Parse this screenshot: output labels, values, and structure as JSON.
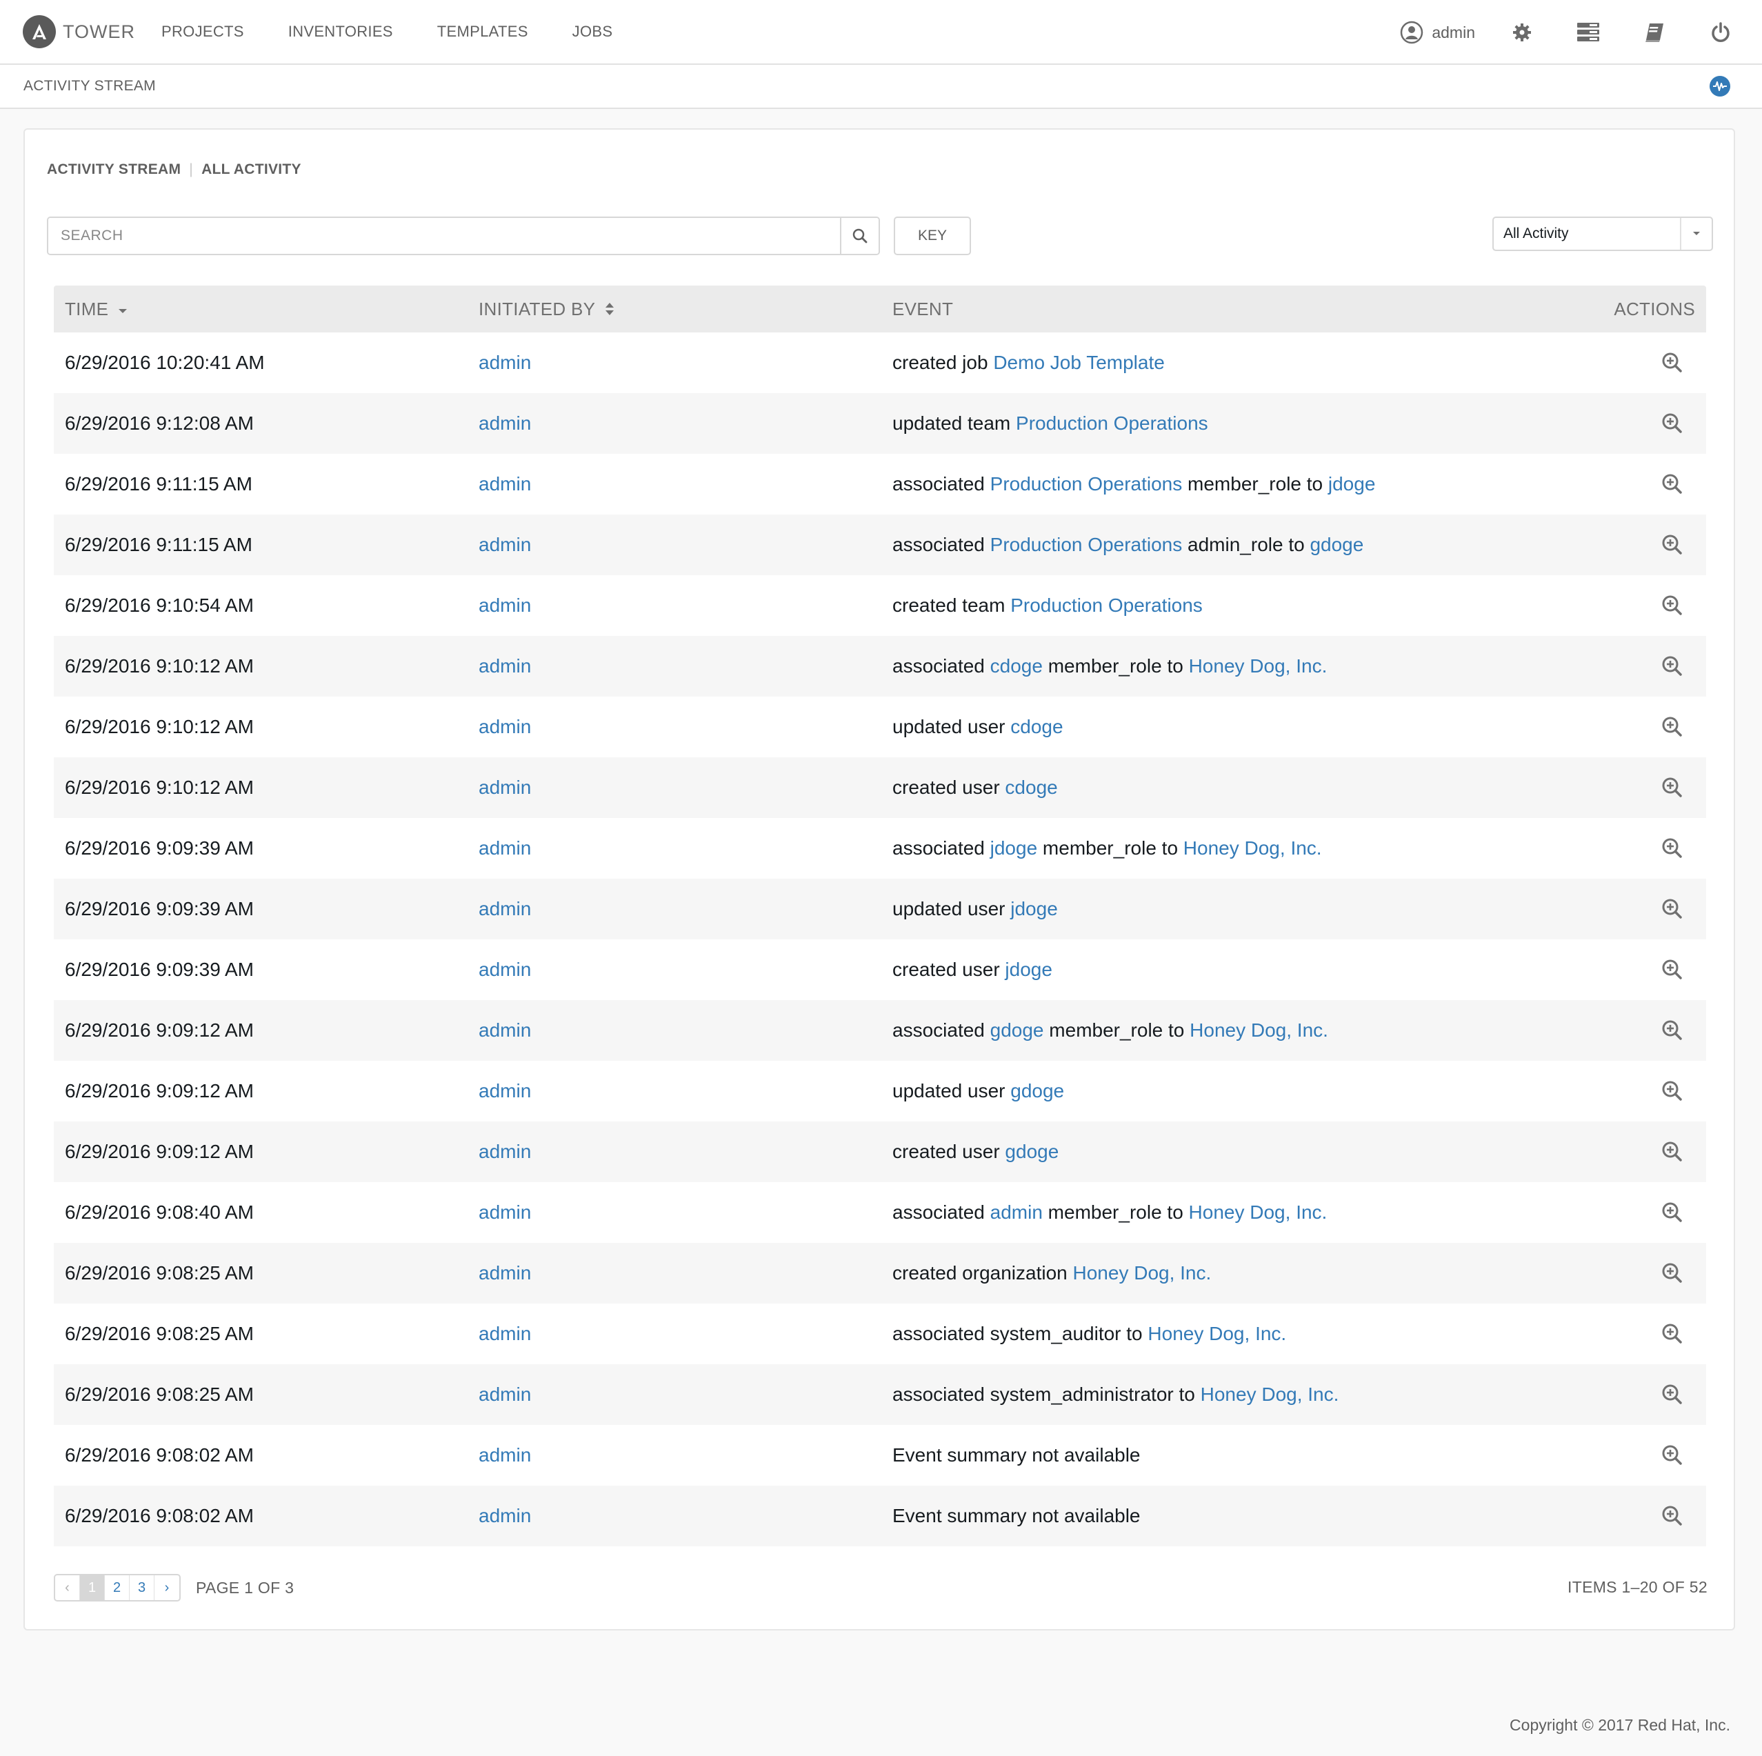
{
  "brand": {
    "name": "TOWER"
  },
  "nav": {
    "links": [
      "PROJECTS",
      "INVENTORIES",
      "TEMPLATES",
      "JOBS"
    ],
    "user": "admin"
  },
  "breadcrumb": "ACTIVITY STREAM",
  "panel": {
    "title": "ACTIVITY STREAM",
    "subtitle": "ALL ACTIVITY",
    "search_placeholder": "SEARCH",
    "key_label": "KEY",
    "filter_value": "All Activity"
  },
  "table": {
    "headers": {
      "time": "TIME",
      "initiated_by": "INITIATED BY",
      "event": "EVENT",
      "actions": "ACTIONS"
    },
    "rows": [
      {
        "time": "6/29/2016 10:20:41 AM",
        "user": "admin",
        "event": [
          [
            "created job ",
            false
          ],
          [
            "Demo Job Template",
            true
          ]
        ]
      },
      {
        "time": "6/29/2016 9:12:08 AM",
        "user": "admin",
        "event": [
          [
            "updated team ",
            false
          ],
          [
            "Production Operations",
            true
          ]
        ]
      },
      {
        "time": "6/29/2016 9:11:15 AM",
        "user": "admin",
        "event": [
          [
            "associated ",
            false
          ],
          [
            "Production Operations",
            true
          ],
          [
            " member_role to ",
            false
          ],
          [
            "jdoge",
            true
          ]
        ]
      },
      {
        "time": "6/29/2016 9:11:15 AM",
        "user": "admin",
        "event": [
          [
            "associated ",
            false
          ],
          [
            "Production Operations",
            true
          ],
          [
            " admin_role to ",
            false
          ],
          [
            "gdoge",
            true
          ]
        ]
      },
      {
        "time": "6/29/2016 9:10:54 AM",
        "user": "admin",
        "event": [
          [
            "created team ",
            false
          ],
          [
            "Production Operations",
            true
          ]
        ]
      },
      {
        "time": "6/29/2016 9:10:12 AM",
        "user": "admin",
        "event": [
          [
            "associated ",
            false
          ],
          [
            "cdoge",
            true
          ],
          [
            " member_role to ",
            false
          ],
          [
            "Honey Dog, Inc.",
            true
          ]
        ]
      },
      {
        "time": "6/29/2016 9:10:12 AM",
        "user": "admin",
        "event": [
          [
            "updated user ",
            false
          ],
          [
            "cdoge",
            true
          ]
        ]
      },
      {
        "time": "6/29/2016 9:10:12 AM",
        "user": "admin",
        "event": [
          [
            "created user ",
            false
          ],
          [
            "cdoge",
            true
          ]
        ]
      },
      {
        "time": "6/29/2016 9:09:39 AM",
        "user": "admin",
        "event": [
          [
            "associated ",
            false
          ],
          [
            "jdoge",
            true
          ],
          [
            " member_role to ",
            false
          ],
          [
            "Honey Dog, Inc.",
            true
          ]
        ]
      },
      {
        "time": "6/29/2016 9:09:39 AM",
        "user": "admin",
        "event": [
          [
            "updated user ",
            false
          ],
          [
            "jdoge",
            true
          ]
        ]
      },
      {
        "time": "6/29/2016 9:09:39 AM",
        "user": "admin",
        "event": [
          [
            "created user ",
            false
          ],
          [
            "jdoge",
            true
          ]
        ]
      },
      {
        "time": "6/29/2016 9:09:12 AM",
        "user": "admin",
        "event": [
          [
            "associated ",
            false
          ],
          [
            "gdoge",
            true
          ],
          [
            " member_role to ",
            false
          ],
          [
            "Honey Dog, Inc.",
            true
          ]
        ]
      },
      {
        "time": "6/29/2016 9:09:12 AM",
        "user": "admin",
        "event": [
          [
            "updated user ",
            false
          ],
          [
            "gdoge",
            true
          ]
        ]
      },
      {
        "time": "6/29/2016 9:09:12 AM",
        "user": "admin",
        "event": [
          [
            "created user ",
            false
          ],
          [
            "gdoge",
            true
          ]
        ]
      },
      {
        "time": "6/29/2016 9:08:40 AM",
        "user": "admin",
        "event": [
          [
            "associated ",
            false
          ],
          [
            "admin",
            true
          ],
          [
            " member_role to ",
            false
          ],
          [
            "Honey Dog, Inc.",
            true
          ]
        ]
      },
      {
        "time": "6/29/2016 9:08:25 AM",
        "user": "admin",
        "event": [
          [
            "created organization ",
            false
          ],
          [
            "Honey Dog, Inc.",
            true
          ]
        ]
      },
      {
        "time": "6/29/2016 9:08:25 AM",
        "user": "admin",
        "event": [
          [
            "associated system_auditor to ",
            false
          ],
          [
            "Honey Dog, Inc.",
            true
          ]
        ]
      },
      {
        "time": "6/29/2016 9:08:25 AM",
        "user": "admin",
        "event": [
          [
            "associated system_administrator to ",
            false
          ],
          [
            "Honey Dog, Inc.",
            true
          ]
        ]
      },
      {
        "time": "6/29/2016 9:08:02 AM",
        "user": "admin",
        "event": [
          [
            "Event summary not available",
            false
          ]
        ]
      },
      {
        "time": "6/29/2016 9:08:02 AM",
        "user": "admin",
        "event": [
          [
            "Event summary not available",
            false
          ]
        ]
      }
    ]
  },
  "pagination": {
    "prev": "‹",
    "next": "›",
    "pages": [
      "1",
      "2",
      "3"
    ],
    "current": "1",
    "page_label": "PAGE 1 OF 3",
    "items_label": "ITEMS 1–20 OF 52"
  },
  "footer": "Copyright © 2017 Red Hat, Inc.",
  "colors": {
    "link": "#337ab7",
    "header_bg": "#ebebeb",
    "row_alt": "#f6f6f6"
  },
  "icons": [
    "tower-logo-icon",
    "user-circle-icon",
    "gear-icon",
    "server-list-icon",
    "book-icon",
    "power-icon",
    "activity-stream-icon",
    "search-icon",
    "chevron-down-icon",
    "sort-desc-icon",
    "sort-both-icon",
    "zoom-in-icon"
  ]
}
